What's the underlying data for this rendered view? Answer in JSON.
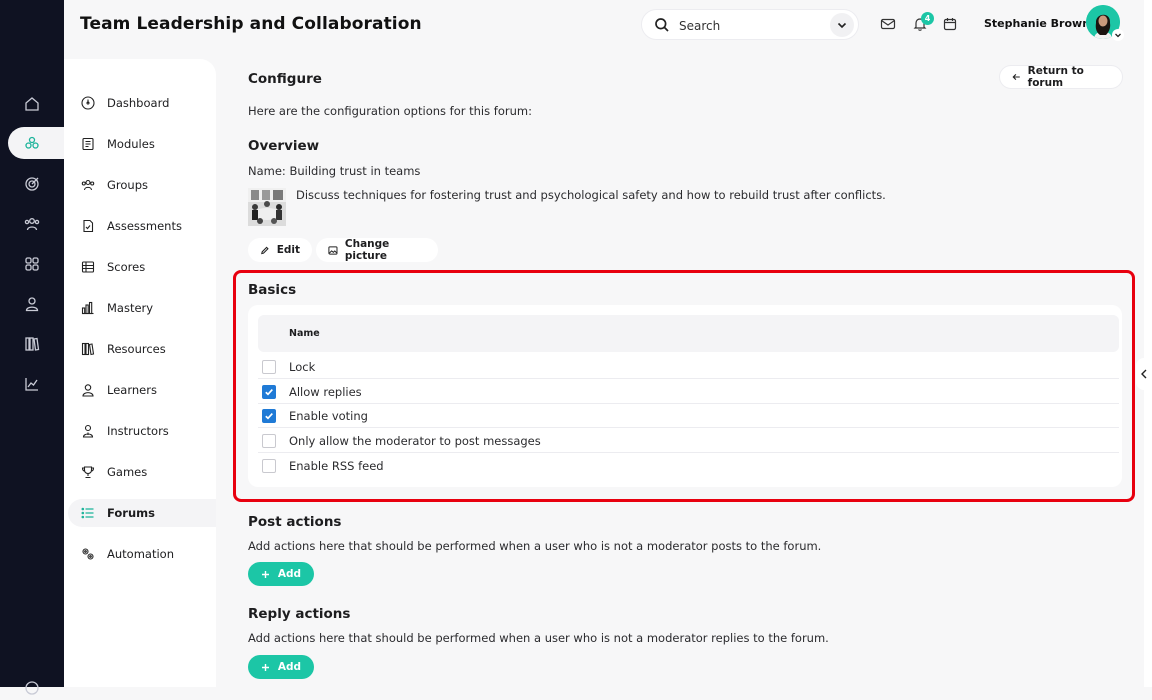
{
  "header": {
    "title": "Team Leadership and Collaboration",
    "search_placeholder": "Search",
    "notification_count": "4",
    "user_name": "Stephanie Brown"
  },
  "rail": {
    "icons": [
      "home-icon",
      "modules-hub-icon",
      "target-icon",
      "people-icon",
      "grid-icon",
      "person-icon",
      "library-icon",
      "chart-line-icon"
    ]
  },
  "sidenav": {
    "items": [
      {
        "label": "Dashboard",
        "icon": "dashboard-icon"
      },
      {
        "label": "Modules",
        "icon": "modules-icon"
      },
      {
        "label": "Groups",
        "icon": "groups-icon"
      },
      {
        "label": "Assessments",
        "icon": "assessments-icon"
      },
      {
        "label": "Scores",
        "icon": "scores-icon"
      },
      {
        "label": "Mastery",
        "icon": "mastery-icon"
      },
      {
        "label": "Resources",
        "icon": "resources-icon"
      },
      {
        "label": "Learners",
        "icon": "learners-icon"
      },
      {
        "label": "Instructors",
        "icon": "instructors-icon"
      },
      {
        "label": "Games",
        "icon": "games-icon"
      },
      {
        "label": "Forums",
        "icon": "forums-icon",
        "active": true
      },
      {
        "label": "Automation",
        "icon": "automation-icon"
      }
    ]
  },
  "main": {
    "configure_title": "Configure",
    "return_label": "Return to forum",
    "intro": "Here are the configuration options for this forum:",
    "overview_title": "Overview",
    "name_line": "Name: Building trust in teams",
    "description": "Discuss techniques for fostering trust and psychological safety and how to rebuild trust after conflicts.",
    "edit_label": "Edit",
    "change_picture_label": "Change picture",
    "basics_title": "Basics",
    "basics_column": "Name",
    "basics_options": [
      {
        "label": "Lock",
        "checked": false
      },
      {
        "label": "Allow replies",
        "checked": true
      },
      {
        "label": "Enable voting",
        "checked": true
      },
      {
        "label": "Only allow the moderator to post messages",
        "checked": false
      },
      {
        "label": "Enable RSS feed",
        "checked": false
      }
    ],
    "post_actions_title": "Post actions",
    "post_actions_desc": "Add actions here that should be performed when a user who is not a moderator posts to the forum.",
    "reply_actions_title": "Reply actions",
    "reply_actions_desc": "Add actions here that should be performed when a user who is not a moderator replies to the forum.",
    "add_label": "Add"
  },
  "colors": {
    "accent": "#1cc6a6",
    "checkbox": "#1f7ad6",
    "highlight": "#e8000f",
    "rail": "#0f1222"
  }
}
